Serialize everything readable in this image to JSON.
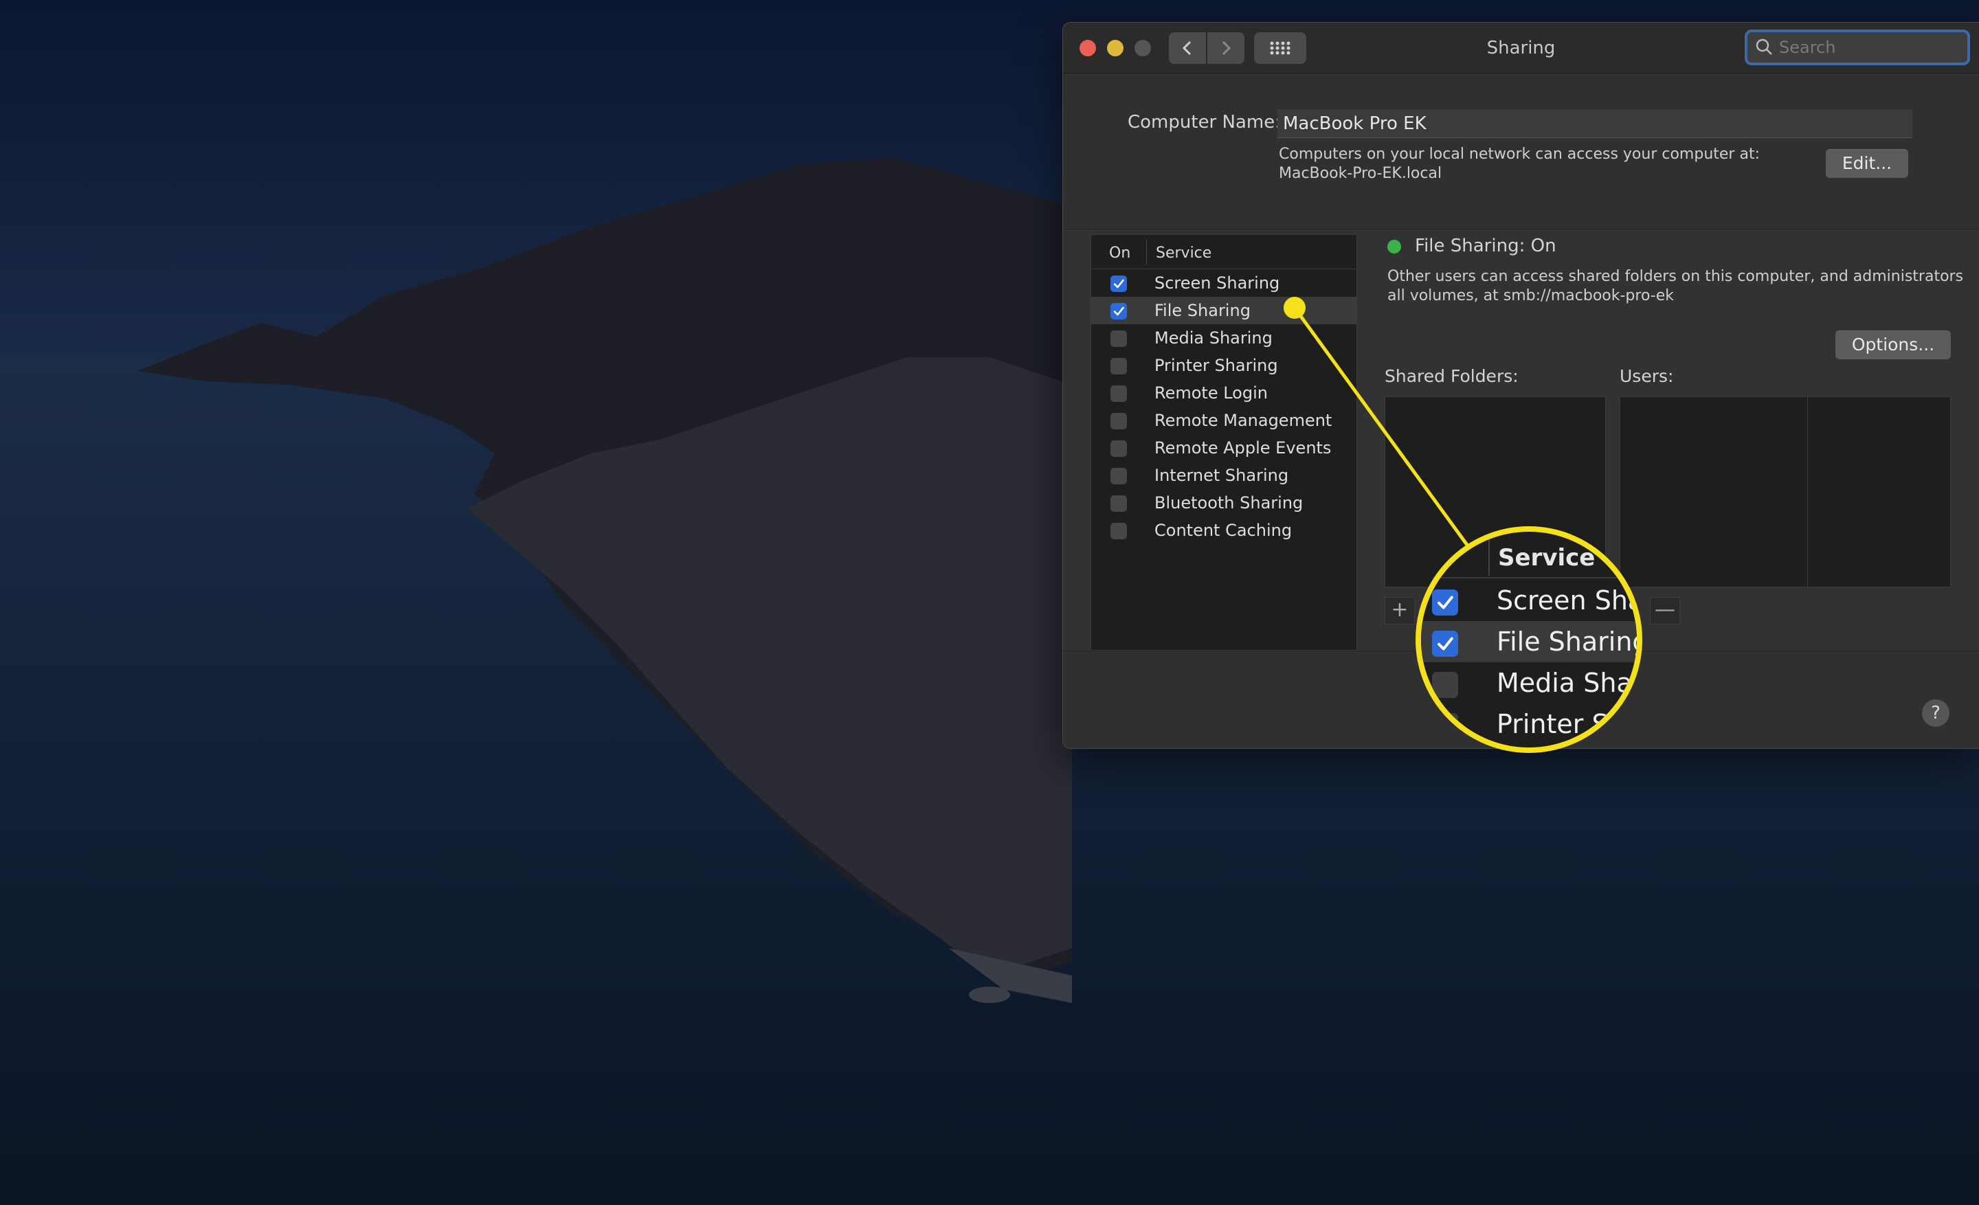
{
  "window": {
    "title": "Sharing",
    "search_placeholder": "Search"
  },
  "computer_name": {
    "label": "Computer Name:",
    "value": "MacBook Pro EK",
    "info_line1": "Computers on your local network can access your computer at:",
    "info_line2": "MacBook-Pro-EK.local",
    "edit_label": "Edit..."
  },
  "services": {
    "col_on": "On",
    "col_service": "Service",
    "items": [
      {
        "label": "Screen Sharing",
        "checked": true,
        "selected": false
      },
      {
        "label": "File Sharing",
        "checked": true,
        "selected": true
      },
      {
        "label": "Media Sharing",
        "checked": false,
        "selected": false
      },
      {
        "label": "Printer Sharing",
        "checked": false,
        "selected": false
      },
      {
        "label": "Remote Login",
        "checked": false,
        "selected": false
      },
      {
        "label": "Remote Management",
        "checked": false,
        "selected": false
      },
      {
        "label": "Remote Apple Events",
        "checked": false,
        "selected": false
      },
      {
        "label": "Internet Sharing",
        "checked": false,
        "selected": false
      },
      {
        "label": "Bluetooth Sharing",
        "checked": false,
        "selected": false
      },
      {
        "label": "Content Caching",
        "checked": false,
        "selected": false
      }
    ]
  },
  "detail": {
    "status": "File Sharing: On",
    "status_color": "#3ab34a",
    "desc_line1": "Other users can access shared folders on this computer, and administrators",
    "desc_line2": "all volumes, at smb://macbook-pro-ek",
    "options_label": "Options...",
    "shared_folders_label": "Shared Folders:",
    "users_label": "Users:",
    "add_label": "+",
    "remove_label": "—"
  },
  "help_label": "?",
  "zoom": {
    "header": "Service",
    "rows": [
      {
        "label": "Screen Sha",
        "checked": true,
        "selected": false
      },
      {
        "label": "File Sharing",
        "checked": true,
        "selected": true
      },
      {
        "label": "Media Shari",
        "checked": false,
        "selected": false
      },
      {
        "label": "Printer Sh",
        "checked": false,
        "selected": false
      }
    ]
  },
  "colors": {
    "accent": "#2f6ad9",
    "highlight": "#f4e11a",
    "close": "#ec5f57",
    "minimize": "#e0b93a"
  }
}
